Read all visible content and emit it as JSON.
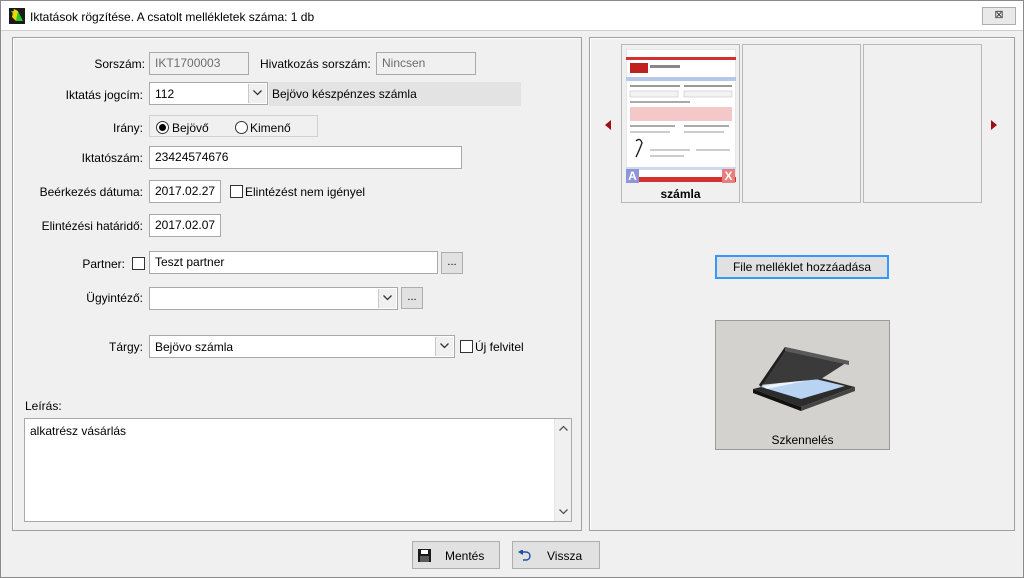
{
  "window": {
    "title": "Iktatások rögzítése. A csatolt mellékletek száma: 1 db",
    "close_label": "⊠"
  },
  "form": {
    "sorszam_label": "Sorszám:",
    "sorszam_value": "IKT1700003",
    "hivatkozas_label": "Hivatkozás sorszám:",
    "hivatkozas_value": "Nincsen",
    "jogcim_label": "Iktatás jogcím:",
    "jogcim_value": "112",
    "jogcim_desc": "Bejövo készpénzes számla",
    "irany_label": "Irány:",
    "irany_options": [
      "Bejövő",
      "Kimenő"
    ],
    "irany_selected": "Bejövő",
    "iktatoszam_label": "Iktatószám:",
    "iktatoszam_value": "23424574676",
    "beerkezes_label": "Beérkezés dátuma:",
    "beerkezes_value": "2017.02.27",
    "nem_igenyel_label": "Elintézést nem igényel",
    "hatarido_label": "Elintézési határidő:",
    "hatarido_value": "2017.02.07",
    "partner_label": "Partner:",
    "partner_value": "Teszt partner",
    "ugyintezo_label": "Ügyintéző:",
    "ugyintezo_value": "",
    "targy_label": "Tárgy:",
    "targy_value": "Bejövo számla",
    "uj_felvitel_label": "Új felvitel",
    "leiras_label": "Leírás:",
    "leiras_value": "alkatrész vásárlás",
    "ellipsis": "..."
  },
  "attachments": {
    "items": [
      {
        "label": "számla",
        "badge_left": "A",
        "badge_right": "X"
      }
    ],
    "add_file_label": "File melléklet hozzáadása",
    "scan_label": "Szkennelés"
  },
  "footer": {
    "save_label": "Mentés",
    "back_label": "Vissza"
  },
  "colors": {
    "accent_blue": "#3399ff",
    "badge_a": "#8e95d8",
    "badge_x": "#e87f7f",
    "nav_arrow": "#a01010"
  }
}
